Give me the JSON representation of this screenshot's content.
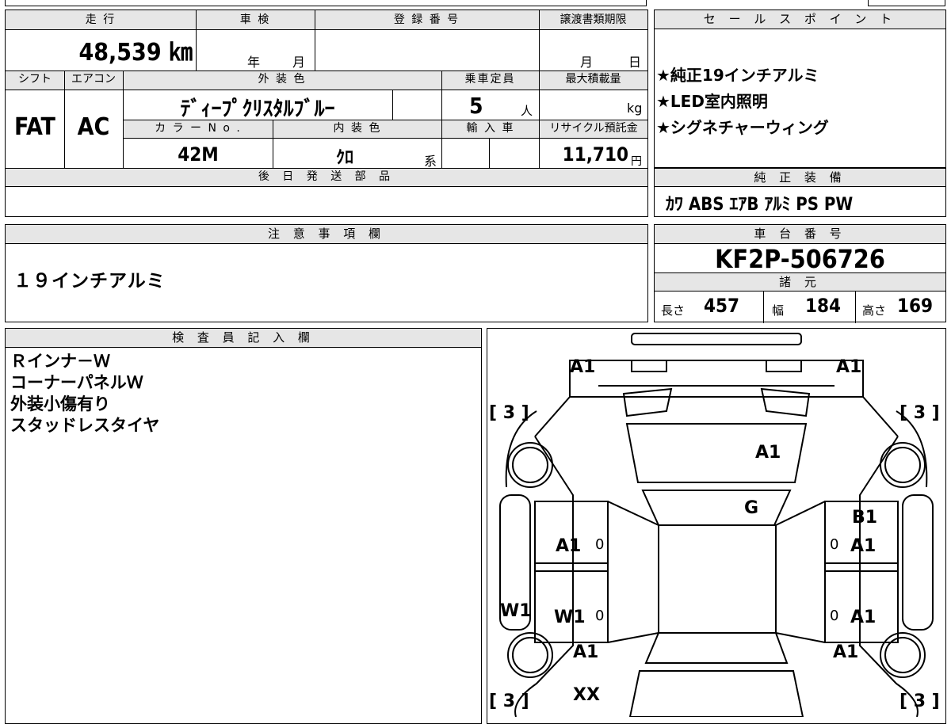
{
  "top_table": {
    "mileage_header": "走 行",
    "mileage_value": "48,539 ㎞",
    "shaken_header": "車 検",
    "shaken_year_unit": "年",
    "shaken_month_unit": "月",
    "registration_header": "登 録 番 号",
    "transfer_header": "譲渡書類期限",
    "transfer_month_unit": "月",
    "transfer_day_unit": "日",
    "shift_header": "シフト",
    "shift_value": "FAT",
    "ac_header": "エアコン",
    "ac_value": "AC",
    "exterior_color_header": "外 装 色",
    "exterior_color_value": "ﾃﾞｨｰﾌﾟｸﾘｽﾀﾙﾌﾞﾙｰ",
    "capacity_header": "乗車定員",
    "capacity_value": "5",
    "capacity_unit": "人",
    "max_load_header": "最大積載量",
    "max_load_unit": "kg",
    "color_no_header": "カ ラ ー N o .",
    "color_no_value": "42M",
    "interior_color_header": "内 装 色",
    "interior_color_value": "ｸﾛ",
    "interior_color_suffix": "系",
    "import_header": "輸 入 車",
    "recycle_header": "リサイクル預託金",
    "recycle_value": "11,710",
    "recycle_unit": "円",
    "later_parts_header": "後 日 発 送 部 品"
  },
  "sales_points": {
    "header": "セ ー ル ス ポ イ ン ト",
    "items": [
      "★純正19インチアルミ",
      "★LED室内照明",
      "★シグネチャーウィング"
    ]
  },
  "genuine_equipment": {
    "header": "純 正 装 備",
    "value": "ｶﾜ ABS ｴｱB ｱﾙﾐ PS PW"
  },
  "notes": {
    "header": "注 意 事 項 欄",
    "value": "１９インチアルミ"
  },
  "chassis": {
    "header": "車 台 番 号",
    "value": "KF2P-506726",
    "specs_header": "諸 元",
    "length_label": "長さ",
    "length_value": "457",
    "width_label": "幅",
    "width_value": "184",
    "height_label": "高さ",
    "height_value": "169"
  },
  "inspector": {
    "header": "検 査 員 記 入 欄",
    "lines": [
      "Ｒインナ－Ｗ",
      "コーナーパネルＷ",
      "外装小傷有り",
      "スタッドレスタイヤ"
    ]
  },
  "diagram": {
    "labels": {
      "front_left": "A1",
      "front_right": "A1",
      "tire_fl": "[ 3 ]",
      "tire_fr": "[ 3 ]",
      "tire_rl": "[ 3 ]",
      "tire_rr": "[ 3 ]",
      "hood": "A1",
      "windshield": "G",
      "right_fender_top": "B1",
      "left_front_door": "A1",
      "left_front_door_zero": "0",
      "right_front_door": "A1",
      "right_front_door_zero": "0",
      "left_side_w": "W1",
      "left_rear_door": "W1",
      "left_rear_door_zero": "0",
      "right_rear_door": "A1",
      "right_rear_door_zero": "0",
      "left_rear_fender": "A1",
      "right_rear_fender": "A1",
      "rear": "XX"
    }
  }
}
